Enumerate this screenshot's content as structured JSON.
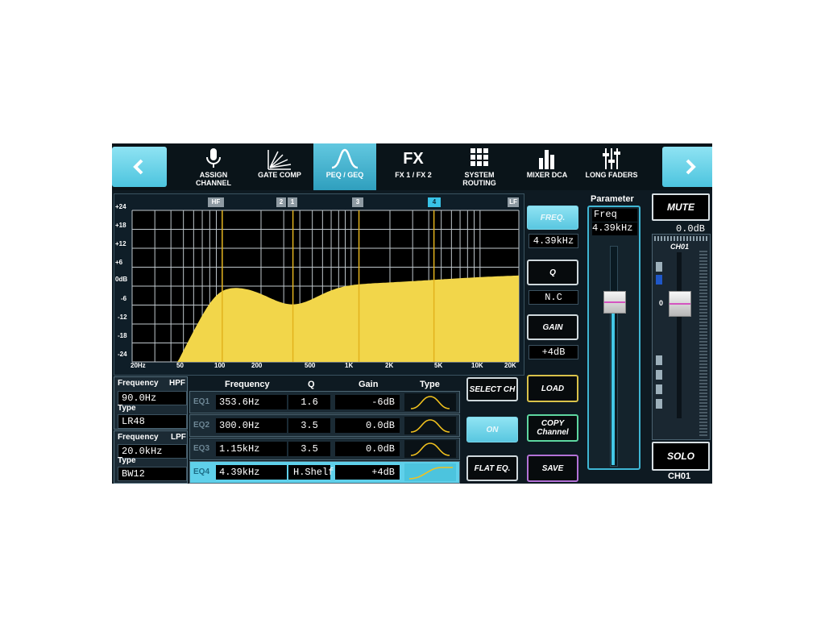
{
  "nav": {
    "prev_icon": "chevron-left-icon",
    "next_icon": "chevron-right-icon"
  },
  "tabs": [
    {
      "icon": "microphone-icon",
      "label_line1": "ASSIGN",
      "label_line2": "CHANNEL",
      "active": false
    },
    {
      "icon": "gate-comp-icon",
      "label_line1": "GATE COMP",
      "label_line2": "",
      "active": false
    },
    {
      "icon": "peq-curve-icon",
      "label_line1": "PEQ / GEQ",
      "label_line2": "",
      "active": true
    },
    {
      "icon": "fx-icon",
      "icon_text": "FX",
      "label_line1": "FX 1 / FX 2",
      "label_line2": "",
      "active": false
    },
    {
      "icon": "grid-icon",
      "label_line1": "SYSTEM",
      "label_line2": "ROUTING",
      "active": false
    },
    {
      "icon": "bars-icon",
      "label_line1": "MIXER DCA",
      "label_line2": "",
      "active": false
    },
    {
      "icon": "sliders-icon",
      "label_line1": "LONG FADERS",
      "label_line2": "",
      "active": false
    }
  ],
  "graph": {
    "y_labels": [
      "+24",
      "+18",
      "+12",
      "+6",
      "0dB",
      "-6",
      "-12",
      "-18",
      "-24"
    ],
    "x_labels": [
      "20Hz",
      "50",
      "100",
      "200",
      "500",
      "1K",
      "2K",
      "5K",
      "10K",
      "20K"
    ],
    "markers": [
      "HF",
      "2",
      "1",
      "3",
      "4",
      "LF"
    ],
    "colors": {
      "fill": "#f2d64a",
      "grid": "#bfc7cc",
      "marker_line": "#e2b21c",
      "background": "#000000"
    }
  },
  "hpf": {
    "title": "Frequency",
    "tag": "HPF",
    "freq": "90.0Hz",
    "type_label": "Type",
    "type": "LR48"
  },
  "lpf": {
    "title": "Frequency",
    "tag": "LPF",
    "freq": "20.0kHz",
    "type_label": "Type",
    "type": "BW12"
  },
  "eq_table": {
    "headers": {
      "frequency": "Frequency",
      "q": "Q",
      "gain": "Gain",
      "type": "Type"
    },
    "rows": [
      {
        "name": "EQ1",
        "freq": "353.6Hz",
        "q": "1.6",
        "gain": "-6dB",
        "type_icon": "bell-icon",
        "selected": false
      },
      {
        "name": "EQ2",
        "freq": "300.0Hz",
        "q": "3.5",
        "gain": "0.0dB",
        "type_icon": "bell-icon",
        "selected": false
      },
      {
        "name": "EQ3",
        "freq": "1.15kHz",
        "q": "3.5",
        "gain": "0.0dB",
        "type_icon": "bell-icon",
        "selected": false
      },
      {
        "name": "EQ4",
        "freq": "4.39kHz",
        "q": "H.Shelf",
        "gain": "+4dB",
        "type_icon": "high-shelf-icon",
        "selected": true
      }
    ]
  },
  "buttons": {
    "select_ch": "SELECT CH",
    "on": "ON",
    "flat_eq": "FLAT EQ.",
    "load": "LOAD",
    "copy_line1": "COPY",
    "copy_line2": "Channel",
    "save": "SAVE"
  },
  "params": {
    "freq_btn": "FREQ.",
    "freq_val": "4.39kHz",
    "q_btn": "Q",
    "q_val": "N.C",
    "gain_btn": "GAIN",
    "gain_val": "+4dB"
  },
  "parameter_panel": {
    "title": "Parameter",
    "name": "Freq",
    "value": "4.39kHz"
  },
  "channel": {
    "mute": "MUTE",
    "level": "0.0dB",
    "strip_label": "CH01",
    "zero_mark": "0",
    "solo": "SOLO",
    "name": "CH01"
  }
}
